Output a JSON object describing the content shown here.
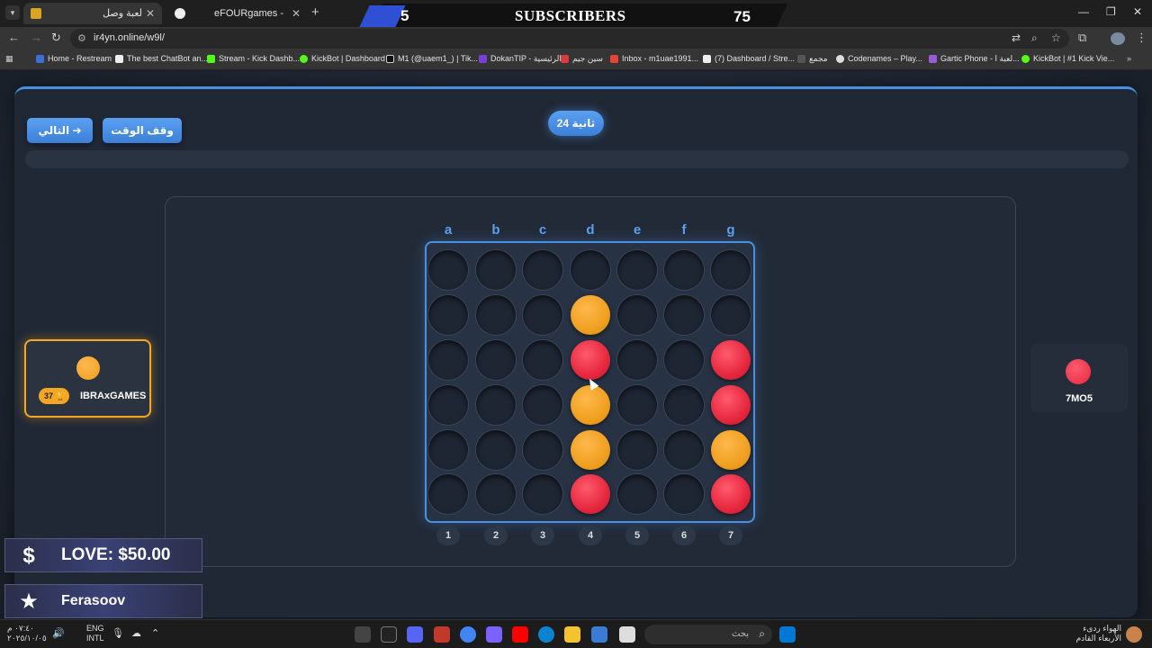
{
  "browser": {
    "tabs": [
      {
        "title": "لعبة وصل"
      },
      {
        "title": "eFOURgames - الألعاب"
      }
    ],
    "url": "ir4yn.online/w9l/",
    "bookmarks": [
      "Home - Restream",
      "The best ChatBot an...",
      "Stream - Kick Dashb...",
      "KickBot | Dashboard",
      "M1 (@uaem1_) | Tik...",
      "DokanTIP - الرئيسية",
      "سين جيم",
      "Inbox - m1uae1991...",
      "(7) Dashboard / Stre...",
      "مجمع",
      "Codenames – Play...",
      "Gartic Phone - لعبة ا...",
      "KickBot | #1 Kick Vie..."
    ]
  },
  "banner": {
    "left_number": "5",
    "title": "SUBSCRIBERS",
    "right_number": "75"
  },
  "controls": {
    "next_label": "التالي",
    "pause_label": "وقف الوقت",
    "timer_text": "24 ثانية"
  },
  "board": {
    "column_letters": [
      "a",
      "b",
      "c",
      "d",
      "e",
      "f",
      "g"
    ],
    "column_numbers": [
      "1",
      "2",
      "3",
      "4",
      "5",
      "6",
      "7"
    ],
    "grid": [
      [
        "",
        "",
        "",
        "",
        "",
        "",
        ""
      ],
      [
        "",
        "",
        "",
        "O",
        "",
        "",
        ""
      ],
      [
        "",
        "",
        "",
        "R",
        "",
        "",
        "R"
      ],
      [
        "",
        "",
        "",
        "O",
        "",
        "",
        "R"
      ],
      [
        "",
        "",
        "",
        "O",
        "",
        "",
        "O"
      ],
      [
        "",
        "",
        "",
        "R",
        "",
        "",
        "R"
      ]
    ]
  },
  "players": {
    "player1": {
      "name": "IBRAxGAMES",
      "score": "37",
      "color": "#f0a020"
    },
    "player2": {
      "name": "7MO5",
      "color": "#e6283e"
    }
  },
  "overlays": {
    "donation": "LOVE: $50.00",
    "follower": "Ferasoov"
  },
  "taskbar": {
    "time": "٠٧:٤٠ م",
    "date": "٢٠٢٥/١٠/٠٥",
    "lang": "ENG",
    "lang_sub": "INTL",
    "search_placeholder": "بحث",
    "weather_line1": "الهواء ردىء",
    "weather_line2": "الأربعاء القادم"
  }
}
